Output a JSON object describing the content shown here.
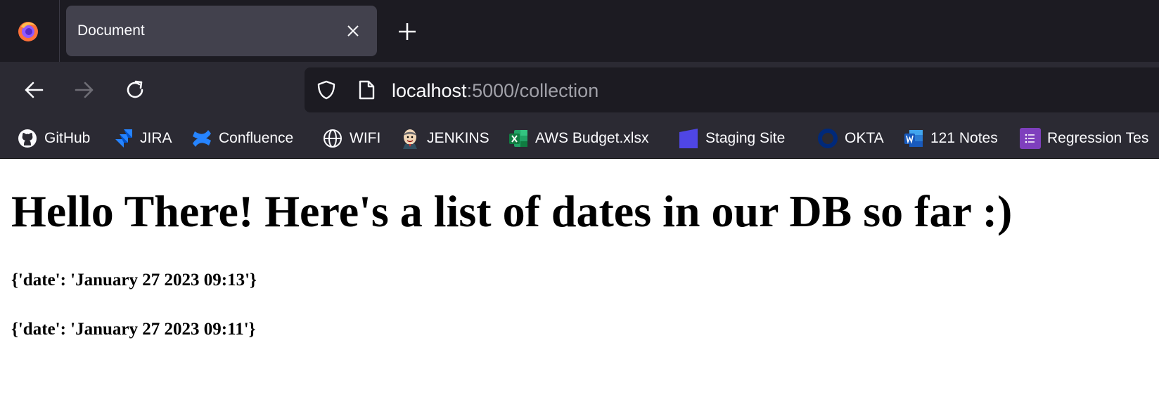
{
  "browser": {
    "tab": {
      "title": "Document",
      "close_icon": "close-icon"
    },
    "new_tab_icon": "plus-icon",
    "nav": {
      "back_icon": "arrow-left-icon",
      "forward_icon": "arrow-right-icon",
      "reload_icon": "reload-icon"
    },
    "url": {
      "host": "localhost",
      "rest": ":5000/collection"
    },
    "bookmarks": [
      {
        "label": "GitHub",
        "icon": "github-icon"
      },
      {
        "label": "JIRA",
        "icon": "jira-icon"
      },
      {
        "label": "Confluence",
        "icon": "confluence-icon"
      },
      {
        "label": "WIFI",
        "icon": "globe-icon"
      },
      {
        "label": "JENKINS",
        "icon": "jenkins-icon"
      },
      {
        "label": "AWS Budget.xlsx",
        "icon": "excel-icon"
      },
      {
        "label": "Staging Site",
        "icon": "staging-icon"
      },
      {
        "label": "OKTA",
        "icon": "okta-icon"
      },
      {
        "label": "121 Notes",
        "icon": "word-icon"
      },
      {
        "label": "Regression Tes",
        "icon": "list-icon"
      }
    ]
  },
  "page": {
    "heading": "Hello There! Here's a list of dates in our DB so far :)",
    "entries": [
      "{'date': 'January 27 2023 09:13'}",
      "{'date': 'January 27 2023 09:11'}"
    ]
  }
}
